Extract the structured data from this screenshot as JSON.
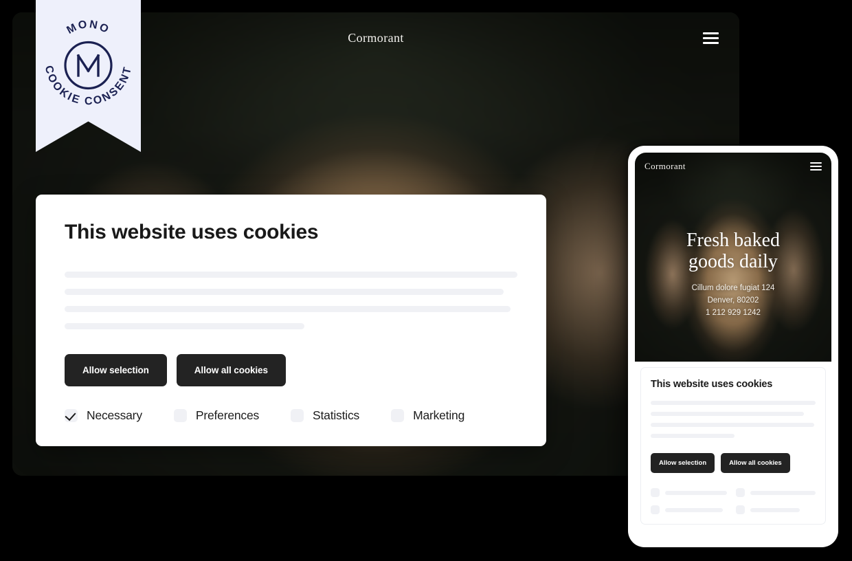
{
  "badge": {
    "text_top": "MONO",
    "text_bottom": "COOKIE CONSENT",
    "monogram": "M",
    "bg_color": "#eef0fb",
    "ink_color": "#1b2152"
  },
  "desktop": {
    "nav": {
      "brand": "Cormorant",
      "menu_icon": "hamburger-icon"
    },
    "cookie_banner": {
      "title": "This website uses cookies",
      "body_placeholder_widths": [
        "100%",
        "97%",
        "98.5%",
        "53%"
      ],
      "buttons": [
        {
          "label": "Allow selection"
        },
        {
          "label": "Allow all cookies"
        }
      ],
      "consent_options": [
        {
          "label": "Necessary",
          "checked": true
        },
        {
          "label": "Preferences",
          "checked": false
        },
        {
          "label": "Statistics",
          "checked": false
        },
        {
          "label": "Marketing",
          "checked": false
        }
      ]
    }
  },
  "mobile": {
    "nav": {
      "brand": "Cormorant",
      "menu_icon": "hamburger-icon"
    },
    "hero": {
      "headline_line1": "Fresh baked",
      "headline_line2": "goods daily",
      "address_line1": "Cillum dolore fugiat 124",
      "address_line2": "Denver, 80202",
      "phone": "1 212 929 1242"
    },
    "cookie_banner": {
      "title": "This website uses cookies",
      "body_placeholder_widths": [
        "100%",
        "93%",
        "99%",
        "51%"
      ],
      "buttons": [
        {
          "label": "Allow selection"
        },
        {
          "label": "Allow all cookies"
        }
      ],
      "consent_placeholder_widths": [
        "78%",
        "88%",
        "72%",
        "62%"
      ]
    }
  },
  "colors": {
    "button_dark": "#232323",
    "skeleton": "#f0f1f5",
    "card_bg": "#ffffff",
    "page_bg": "#000000"
  }
}
